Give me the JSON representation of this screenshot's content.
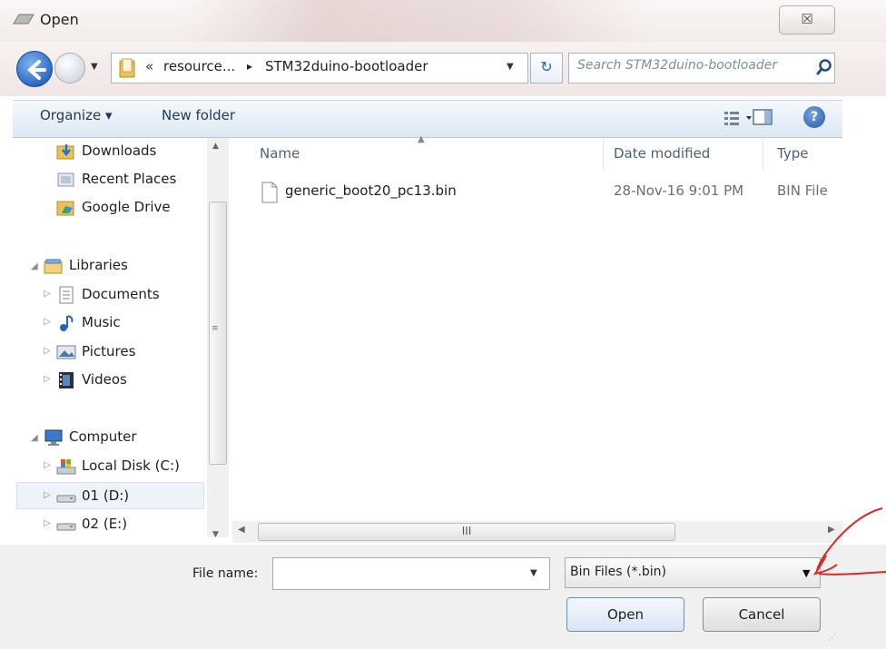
{
  "window": {
    "title": "Open",
    "close_label": "☒"
  },
  "address": {
    "chevron": "«",
    "crumbs": [
      "resource...",
      "STM32duino-bootloader"
    ],
    "separator": "▸",
    "search_placeholder": "Search STM32duino-bootloader"
  },
  "toolbar": {
    "organize": "Organize ▾",
    "new_folder": "New folder",
    "help": "?"
  },
  "nav": {
    "downloads": "Downloads",
    "recent": "Recent Places",
    "gdrive": "Google Drive",
    "libraries": "Libraries",
    "documents": "Documents",
    "music": "Music",
    "pictures": "Pictures",
    "videos": "Videos",
    "computer": "Computer",
    "local_disk": "Local Disk (C:)",
    "drive_d": "01 (D:)",
    "drive_e": "02 (E:)"
  },
  "columns": {
    "name": "Name",
    "date": "Date modified",
    "type": "Type"
  },
  "files": [
    {
      "name": "generic_boot20_pc13.bin",
      "date": "28-Nov-16 9:01 PM",
      "type": "BIN File"
    }
  ],
  "scroll_grip": "III",
  "bottom": {
    "file_name_label": "File name:",
    "file_name_value": "",
    "file_type": "Bin Files (*.bin)",
    "open": "Open",
    "cancel": "Cancel"
  },
  "colors": {
    "annotation": "#d42a2a",
    "accent": "#2c6bc4"
  }
}
